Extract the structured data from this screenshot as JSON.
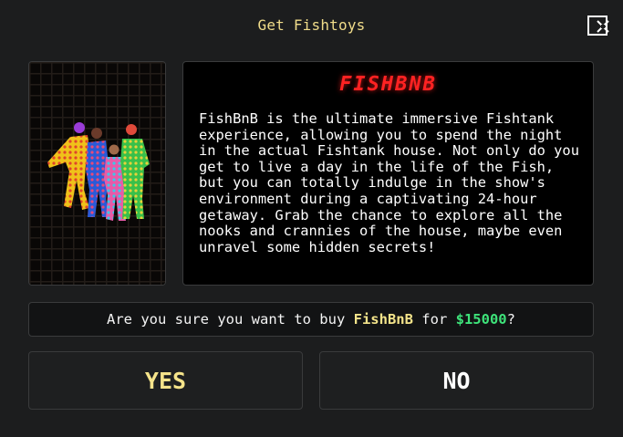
{
  "dialog": {
    "title": "Get Fishtoys",
    "close_icon": "close-x-icon"
  },
  "product": {
    "logo_text": "FISHBNB",
    "image_icon": "fishbnb-characters-image",
    "description": "FishBnB is the ultimate immersive Fishtank experience, allowing you to spend the night in the actual Fishtank house. Not only do you get to live a day in the life of the Fish, but you can totally indulge in the show's environment during a captivating 24-hour getaway. Grab the chance to explore all the nooks and crannies of the house, maybe even unravel some hidden secrets!"
  },
  "confirm": {
    "prefix": "Are you sure you want to buy ",
    "item_name": "FishBnB",
    "middle": " for ",
    "price": "$15000",
    "suffix": "?"
  },
  "buttons": {
    "yes_label": "YES",
    "no_label": "NO"
  },
  "colors": {
    "title": "#f0dc8a",
    "logo": "#ff2222",
    "item_highlight": "#f3e38a",
    "price_highlight": "#3ee37a",
    "yes_label": "#f5e38a"
  }
}
